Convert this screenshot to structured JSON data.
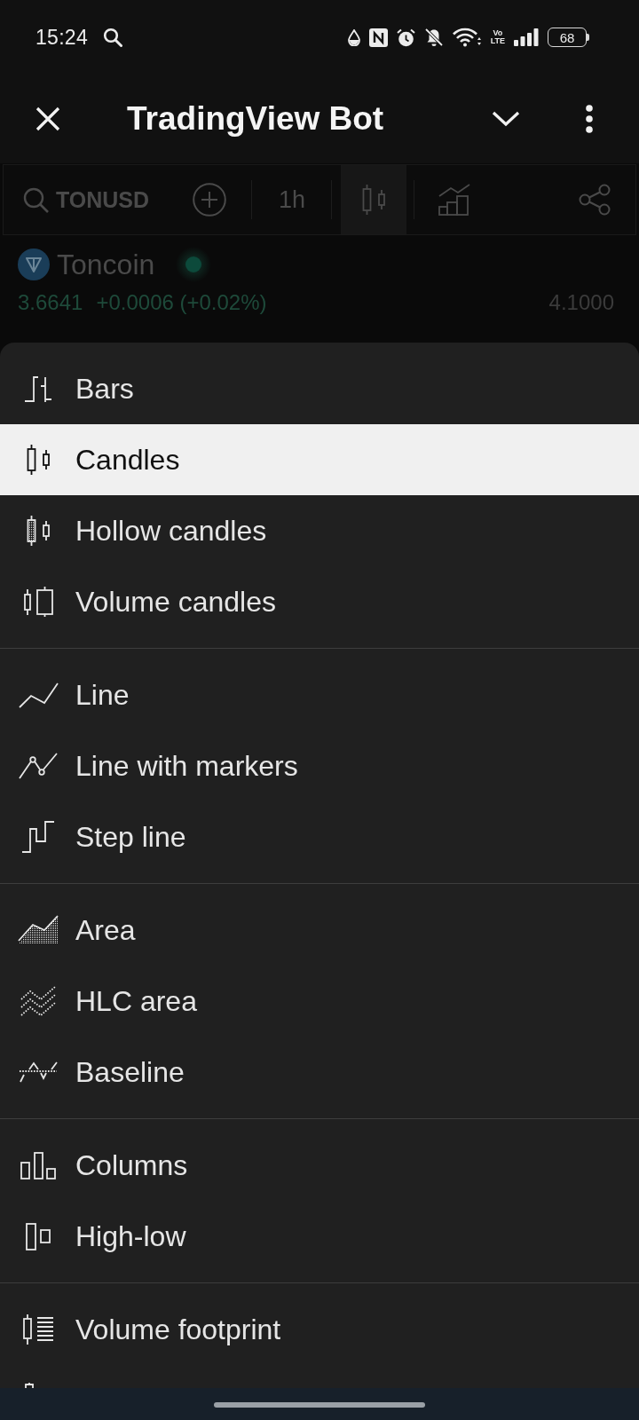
{
  "status_bar": {
    "time": "15:24",
    "network_label": "Vo LTE",
    "battery": "68"
  },
  "header": {
    "title": "TradingView Bot"
  },
  "toolbar": {
    "symbol": "TONUSD",
    "interval": "1h"
  },
  "symbol_info": {
    "name": "Toncoin",
    "price": "3.6641",
    "change": "+0.0006 (+0.02%)",
    "price_scale_label": "4.1000"
  },
  "chart_type_menu": {
    "groups": [
      {
        "items": [
          {
            "kind": "bars",
            "label": "Bars",
            "selected": false
          },
          {
            "kind": "candles",
            "label": "Candles",
            "selected": true
          },
          {
            "kind": "hollow",
            "label": "Hollow candles",
            "selected": false
          },
          {
            "kind": "volume",
            "label": "Volume candles",
            "selected": false
          }
        ]
      },
      {
        "items": [
          {
            "kind": "line",
            "label": "Line",
            "selected": false
          },
          {
            "kind": "markers",
            "label": "Line with markers",
            "selected": false
          },
          {
            "kind": "step",
            "label": "Step line",
            "selected": false
          }
        ]
      },
      {
        "items": [
          {
            "kind": "area",
            "label": "Area",
            "selected": false
          },
          {
            "kind": "hlc",
            "label": "HLC area",
            "selected": false
          },
          {
            "kind": "baseline",
            "label": "Baseline",
            "selected": false
          }
        ]
      },
      {
        "items": [
          {
            "kind": "columns",
            "label": "Columns",
            "selected": false
          },
          {
            "kind": "highlow",
            "label": "High-low",
            "selected": false
          }
        ]
      },
      {
        "items": [
          {
            "kind": "footprint",
            "label": "Volume footprint",
            "selected": false
          }
        ]
      }
    ]
  }
}
